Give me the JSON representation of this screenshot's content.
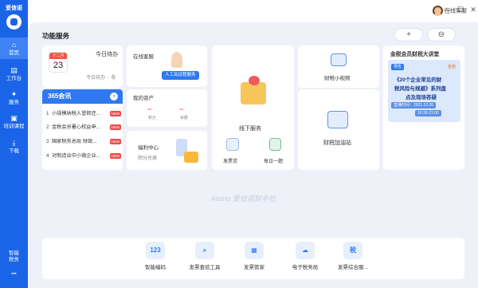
{
  "app": {
    "name": "爱信诺"
  },
  "sidebar": {
    "items": [
      {
        "label": "首页",
        "icon": "home-icon",
        "glyph": "⌂"
      },
      {
        "label": "工作台",
        "icon": "workbench-icon",
        "glyph": "▤"
      },
      {
        "label": "服务",
        "icon": "service-icon",
        "glyph": "✦"
      },
      {
        "label": "培训课程",
        "icon": "course-icon",
        "glyph": "▣"
      },
      {
        "label": "下载",
        "icon": "download-icon",
        "glyph": "⤓"
      }
    ],
    "smart_label_1": "智能",
    "smart_label_2": "税务",
    "more": "•••"
  },
  "topbar": {
    "customer_service": "在线客服",
    "minimize": "—",
    "maximize": "☐",
    "close": "✕"
  },
  "main": {
    "section_title": "功能服务",
    "add_glyph": "+",
    "settings_glyph": "⊖",
    "todo": {
      "cal_month": "十二月",
      "cal_day": "23",
      "title": "今日待办",
      "summary": "今日待办 ·· 条"
    },
    "news": {
      "title": "365会讯",
      "arrow": "›",
      "items": [
        {
          "num": "1",
          "text": "小规模纳税人誉郎还...",
          "badge": "NEW"
        },
        {
          "num": "2",
          "text": "金税会员暑心权益申...",
          "badge": "NEW"
        },
        {
          "num": "3",
          "text": "国家税务总局 财政...",
          "badge": "NEW"
        },
        {
          "num": "4",
          "text": "对制造业中小微企业...",
          "badge": "NEW"
        }
      ]
    },
    "online_service": {
      "title": "在线客服",
      "badge": "人工及远程服务"
    },
    "assets": {
      "title": "我的资产",
      "col1_value": "--",
      "col1_label": "积分",
      "col2_value": "--",
      "col2_label": "余额"
    },
    "welfare": {
      "title": "福利中心",
      "subtitle": "积分兑换"
    },
    "offline": {
      "label": "线下服务"
    },
    "invoice_loan": {
      "label": "发票贷"
    },
    "daily_question": {
      "label": "每日一题"
    },
    "video": {
      "label": "财税小视频"
    },
    "tax_station": {
      "label": "财税加油站"
    },
    "lecture": {
      "title": "金税会员财税大讲堂",
      "tag": "预告",
      "brand": "金税",
      "line1": "《20个企业常见的财",
      "line2": "税风险与规避》系列盘",
      "line3": "点及现场答疑",
      "time_label": "直播时间：2021.12.26",
      "time_range": "19:30-21:00"
    },
    "watermark": "Aisino 爱信诺财手社",
    "tools": [
      {
        "label": "智能编码",
        "icon": "smart-code-icon",
        "glyph": "123"
      },
      {
        "label": "发票查验工具",
        "icon": "invoice-check-icon",
        "glyph": "⌕"
      },
      {
        "label": "发票管家",
        "icon": "invoice-manager-icon",
        "glyph": "▦"
      },
      {
        "label": "电子税务局",
        "icon": "e-tax-bureau-icon",
        "glyph": "☁"
      },
      {
        "label": "发票综合服...",
        "icon": "invoice-service-icon",
        "glyph": "税"
      }
    ]
  }
}
